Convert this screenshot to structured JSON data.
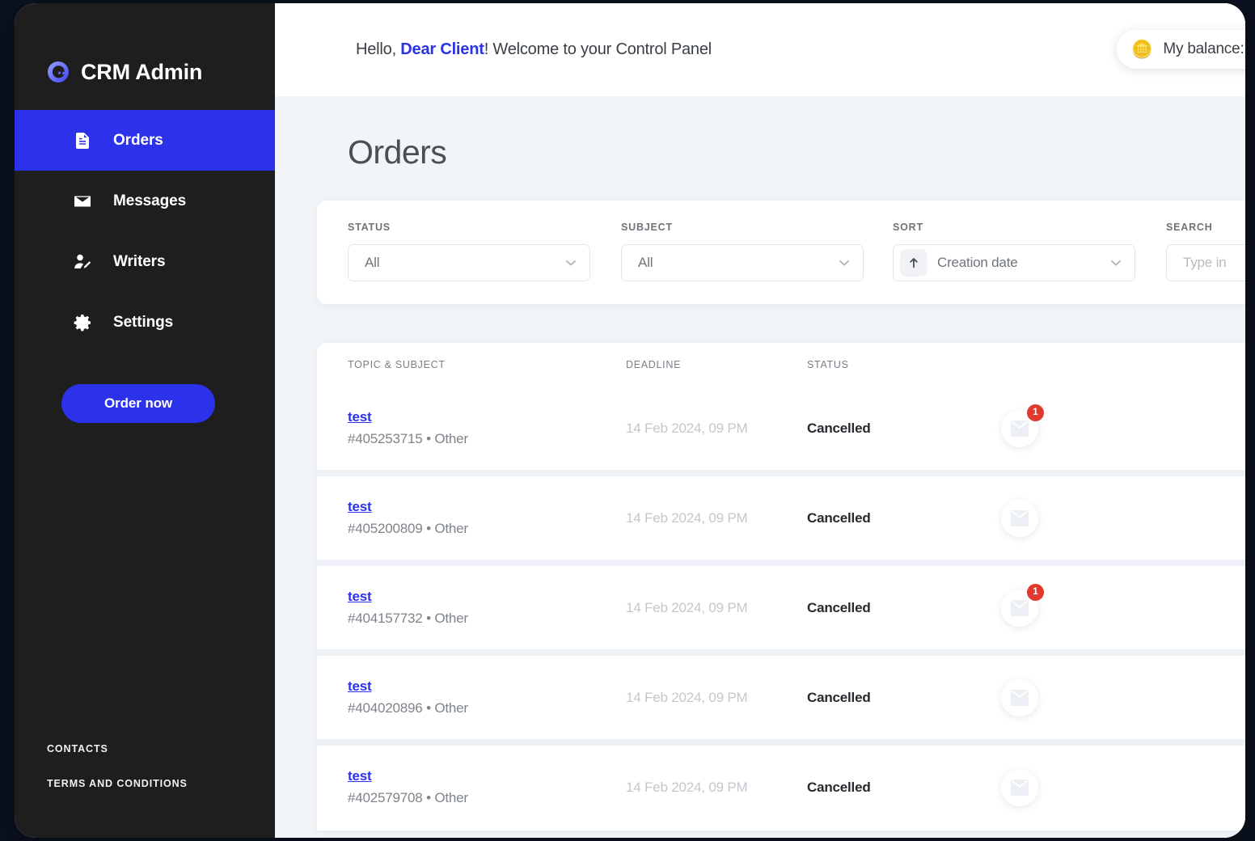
{
  "brand": {
    "title": "CRM Admin",
    "logo_icon": "crm-circle-logo-icon"
  },
  "sidebar": {
    "items": [
      {
        "label": "Orders",
        "icon": "document-icon",
        "active": true
      },
      {
        "label": "Messages",
        "icon": "envelope-icon",
        "active": false
      },
      {
        "label": "Writers",
        "icon": "user-edit-icon",
        "active": false
      },
      {
        "label": "Settings",
        "icon": "gear-icon",
        "active": false
      }
    ],
    "order_button": "Order now",
    "footer_links": [
      "CONTACTS",
      "TERMS AND CONDITIONS"
    ]
  },
  "topbar": {
    "greeting_prefix": "Hello, ",
    "greeting_name": "Dear Client",
    "greeting_suffix": "! Welcome to your Control Panel",
    "balance_label": "My balance: $",
    "balance_icon": "coin-stack-icon"
  },
  "page": {
    "title": "Orders"
  },
  "filters": {
    "status": {
      "label": "STATUS",
      "value": "All"
    },
    "subject": {
      "label": "SUBJECT",
      "value": "All"
    },
    "sort": {
      "label": "SORT",
      "value": "Creation date",
      "direction_icon": "arrow-up-icon"
    },
    "search": {
      "label": "SEARCH",
      "value": "",
      "placeholder": "Type in"
    }
  },
  "table": {
    "columns": [
      "TOPIC & SUBJECT",
      "DEADLINE",
      "STATUS"
    ],
    "rows": [
      {
        "topic": "test",
        "order_id": "#405253715",
        "subject": "Other",
        "deadline": "14 Feb 2024, 09 PM",
        "status": "Cancelled",
        "unread": "1"
      },
      {
        "topic": "test",
        "order_id": "#405200809",
        "subject": "Other",
        "deadline": "14 Feb 2024, 09 PM",
        "status": "Cancelled",
        "unread": ""
      },
      {
        "topic": "test",
        "order_id": "#404157732",
        "subject": "Other",
        "deadline": "14 Feb 2024, 09 PM",
        "status": "Cancelled",
        "unread": "1"
      },
      {
        "topic": "test",
        "order_id": "#404020896",
        "subject": "Other",
        "deadline": "14 Feb 2024, 09 PM",
        "status": "Cancelled",
        "unread": ""
      },
      {
        "topic": "test",
        "order_id": "#402579708",
        "subject": "Other",
        "deadline": "14 Feb 2024, 09 PM",
        "status": "Cancelled",
        "unread": ""
      }
    ]
  },
  "colors": {
    "accent": "#2b32ea",
    "sidebar_bg": "#1e1e1e",
    "content_bg": "#f1f5f8",
    "badge_red": "#e03a2f",
    "page_outer_bg": "#0b111f"
  }
}
